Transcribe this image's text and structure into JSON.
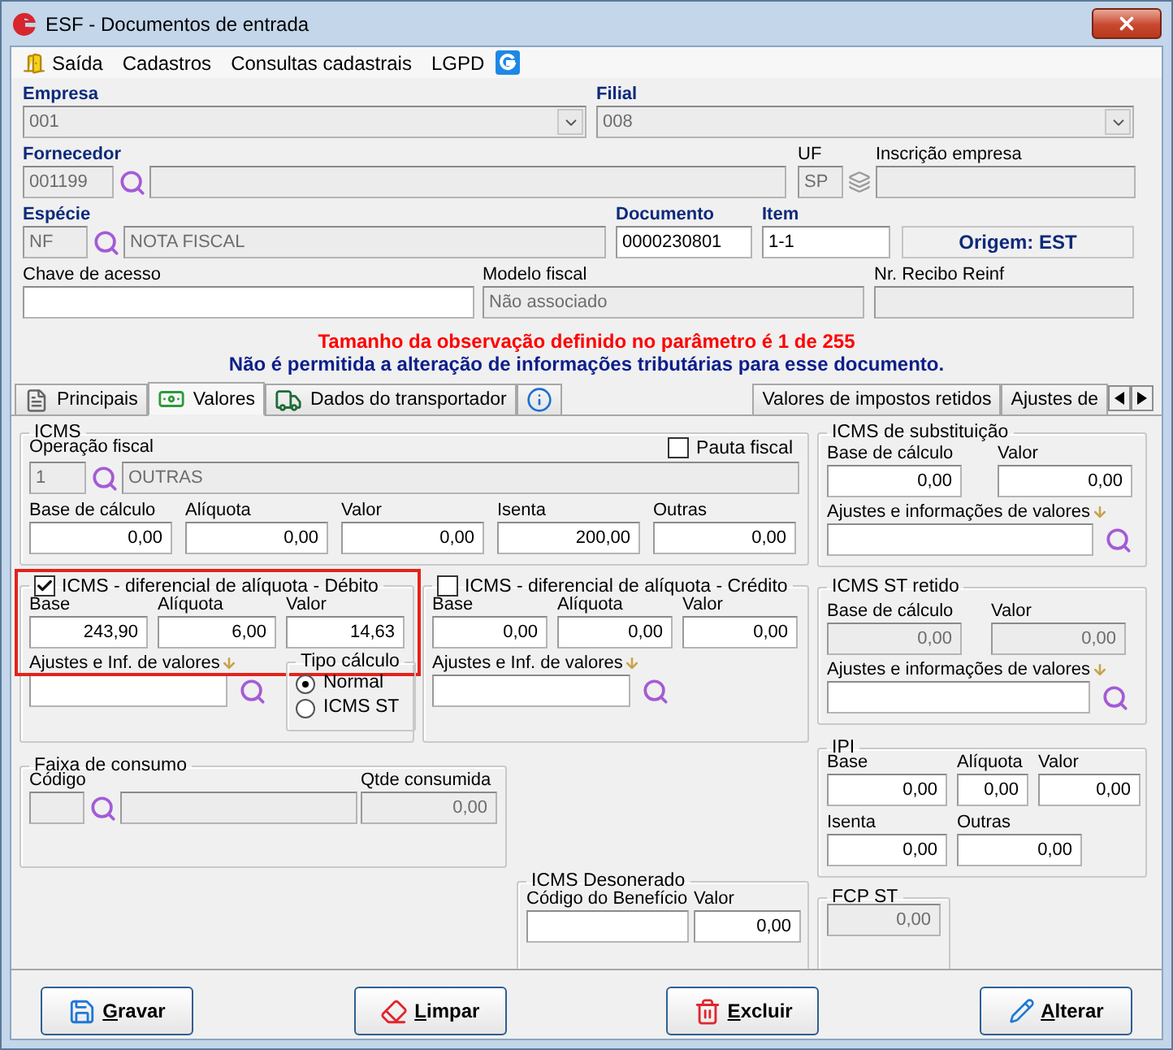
{
  "window": {
    "title": "ESF - Documentos de entrada"
  },
  "menu": [
    {
      "label": "Saída",
      "kind": "exit"
    },
    {
      "label": "Cadastros",
      "kind": "plain"
    },
    {
      "label": "Consultas cadastrais",
      "kind": "plain"
    },
    {
      "label": "LGPD",
      "kind": "plain"
    }
  ],
  "empresa": {
    "label": "Empresa",
    "required": true,
    "value": "001",
    "disabled": true
  },
  "filial": {
    "label": "Filial",
    "required": true,
    "value": "008",
    "disabled": true
  },
  "fornecedor": {
    "label": "Fornecedor",
    "required": true,
    "code": {
      "value": "001199",
      "disabled": true
    },
    "name": {
      "disabled": true
    }
  },
  "uf": {
    "label": "UF",
    "required": false,
    "value": "SP",
    "disabled": true
  },
  "inscricao": {
    "label": "Inscrição empresa",
    "required": false,
    "disabled": true
  },
  "especie": {
    "label": "Espécie",
    "required": true,
    "code": {
      "value": "NF",
      "disabled": true
    },
    "name": {
      "value": "NOTA FISCAL",
      "disabled": true
    }
  },
  "documento": {
    "label": "Documento",
    "required": true,
    "value": "0000230801",
    "disabled": false
  },
  "item": {
    "label": "Item",
    "required": true,
    "value": "1-1",
    "disabled": false
  },
  "origem": "Origem: EST",
  "chave": {
    "label": "Chave de acesso",
    "required": false,
    "disabled": false
  },
  "modelo": {
    "label": "Modelo fiscal",
    "required": false,
    "value": "Não associado",
    "disabled": true
  },
  "recibo": {
    "label": "Nr. Recibo Reinf",
    "required": false,
    "disabled": true
  },
  "messages": [
    {
      "text": "Tamanho da observação definido no parâmetro é 1 de 255",
      "kind": "warning"
    },
    {
      "text": "Não é permitida a alteração de informações tributárias para esse documento.",
      "kind": "info"
    }
  ],
  "tabs": [
    {
      "label": "Principais",
      "kind": "doc",
      "selected": false
    },
    {
      "label": "Valores",
      "kind": "money",
      "selected": true
    },
    {
      "label": "Dados do transportador",
      "kind": "truck",
      "selected": false
    },
    {
      "kind": "info",
      "selected": false
    },
    {
      "label": "Valores de impostos retidos",
      "kind": "plain",
      "selected": false
    },
    {
      "label": "Ajustes de",
      "kind": "plain",
      "selected": false
    }
  ],
  "icms": {
    "title": "ICMS",
    "operacao": {
      "label": "Operação fiscal",
      "code": {
        "value": "1",
        "disabled": true
      },
      "name": {
        "value": "OUTRAS",
        "disabled": true
      }
    },
    "pauta": {
      "label": "Pauta fiscal",
      "checked": false
    },
    "values": [
      {
        "label": "Base de cálculo",
        "value": "0,00",
        "disabled": false
      },
      {
        "label": "Alíquota",
        "value": "0,00",
        "disabled": false
      },
      {
        "label": "Valor",
        "value": "0,00",
        "disabled": false
      },
      {
        "label": "Isenta",
        "value": "200,00",
        "disabled": false
      },
      {
        "label": "Outras",
        "value": "0,00",
        "disabled": false
      }
    ]
  },
  "substituicao": {
    "title": "ICMS de substituição",
    "values": [
      {
        "label": "Base de cálculo",
        "value": "0,00",
        "disabled": false
      },
      {
        "label": "Valor",
        "value": "0,00",
        "disabled": false
      }
    ],
    "ajustes": {
      "label": "Ajustes e informações de valores",
      "disabled": false
    }
  },
  "debito": {
    "title": "ICMS - diferencial de alíquota - Débito",
    "checked": true,
    "highlighted": true,
    "values": [
      {
        "label": "Base",
        "value": "243,90",
        "disabled": false
      },
      {
        "label": "Alíquota",
        "value": "6,00",
        "disabled": false
      },
      {
        "label": "Valor",
        "value": "14,63",
        "disabled": false
      }
    ],
    "ajustes": {
      "label": "Ajustes e Inf. de valores",
      "disabled": false
    },
    "tipo": {
      "title": "Tipo cálculo",
      "options": [
        {
          "label": "Normal",
          "selected": true
        },
        {
          "label": "ICMS ST",
          "selected": false
        }
      ]
    }
  },
  "credito": {
    "title": "ICMS - diferencial de alíquota - Crédito",
    "checked": false,
    "highlighted": false,
    "values": [
      {
        "label": "Base",
        "value": "0,00",
        "disabled": false
      },
      {
        "label": "Alíquota",
        "value": "0,00",
        "disabled": false
      },
      {
        "label": "Valor",
        "value": "0,00",
        "disabled": false
      }
    ],
    "ajustes": {
      "label": "Ajustes e Inf. de valores",
      "disabled": false
    }
  },
  "st_retido": {
    "title": "ICMS ST retido",
    "values": [
      {
        "label": "Base de cálculo",
        "value": "0,00",
        "disabled": true
      },
      {
        "label": "Valor",
        "value": "0,00",
        "disabled": true
      }
    ],
    "ajustes": {
      "label": "Ajustes e informações de valores",
      "disabled": false
    }
  },
  "faixa": {
    "title": "Faixa de consumo",
    "codigo": {
      "label": "Código",
      "disabled": true
    },
    "name": {
      "disabled": true
    },
    "qtde": {
      "label": "Qtde consumida",
      "value": "0,00",
      "disabled": true
    }
  },
  "ipi": {
    "title": "IPI",
    "values": [
      {
        "label": "Base",
        "value": "0,00",
        "disabled": false
      },
      {
        "label": "Alíquota",
        "value": "0,00",
        "disabled": false
      },
      {
        "label": "Valor",
        "value": "0,00",
        "disabled": false
      },
      {
        "label": "Isenta",
        "value": "0,00",
        "disabled": false
      },
      {
        "label": "Outras",
        "value": "0,00",
        "disabled": false
      }
    ]
  },
  "desonerado": {
    "title": "ICMS Desonerado",
    "codigo": {
      "label": "Código do Benefício",
      "disabled": false
    },
    "valor": {
      "label": "Valor",
      "value": "0,00",
      "disabled": false
    }
  },
  "fcp_st": {
    "title": "FCP ST",
    "value": "0,00",
    "disabled": true
  },
  "buttons": [
    {
      "label": "Gravar",
      "kind": "save"
    },
    {
      "label": "Limpar",
      "kind": "clear"
    },
    {
      "label": "Excluir",
      "kind": "delete"
    },
    {
      "label": "Alterar",
      "kind": "edit"
    }
  ]
}
